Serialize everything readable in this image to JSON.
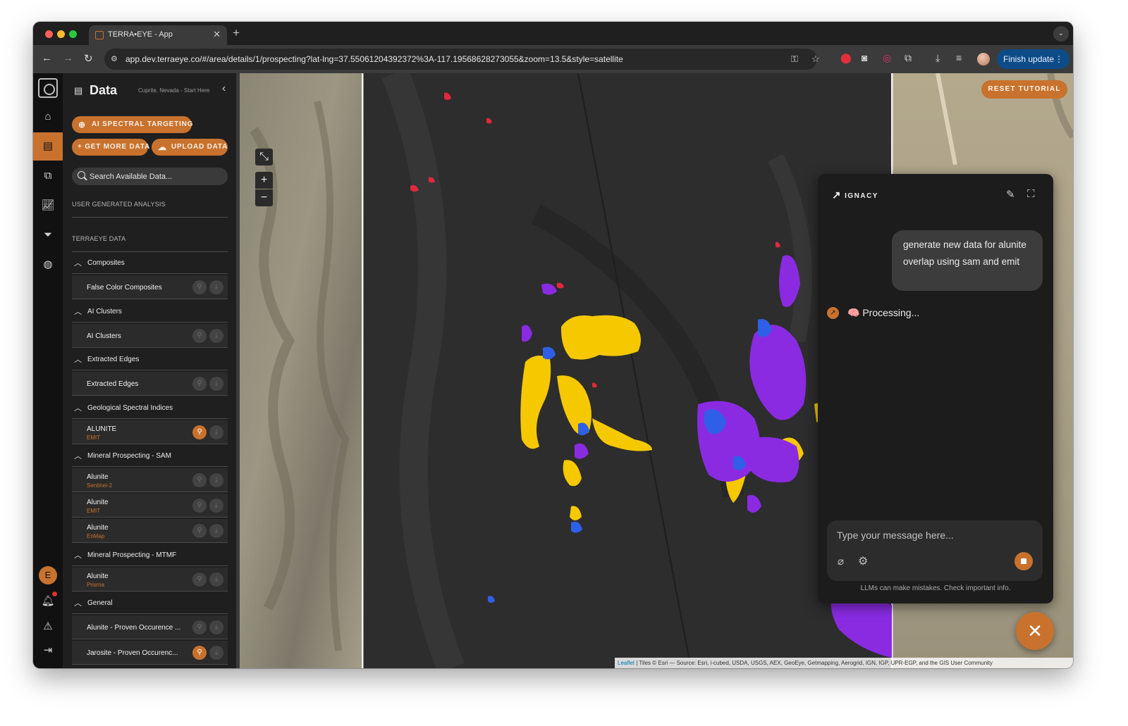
{
  "browser": {
    "tab_title": "TERRA•EYE - App",
    "url": "app.dev.terraeye.co/#/area/details/1/prospecting?lat-lng=37.55061204392372%3A-117.19568628273055&zoom=13.5&style=satellite",
    "finish_update_label": "Finish update"
  },
  "panel": {
    "title": "Data",
    "location": "Cuprite, Nevada - Start Here",
    "ai_targeting_label": "AI SPECTRAL TARGETING",
    "get_more_label": "+ GET MORE DATA",
    "upload_label": "UPLOAD DATA",
    "search_placeholder": "Search Available Data...",
    "user_section": "USER GENERATED ANALYSIS",
    "terraeye_section": "TERRAEYE DATA",
    "groups": [
      {
        "label": "Composites"
      },
      {
        "label": "AI Clusters"
      },
      {
        "label": "Extracted Edges"
      },
      {
        "label": "Geological Spectral Indices"
      },
      {
        "label": "Mineral Prospecting - SAM"
      },
      {
        "label": "Mineral Prospecting - MTMF"
      },
      {
        "label": "General"
      }
    ],
    "layers": [
      {
        "name": "False Color Composites",
        "sub": ""
      },
      {
        "name": "AI Clusters",
        "sub": ""
      },
      {
        "name": "Extracted Edges",
        "sub": ""
      },
      {
        "name": "ALUNITE",
        "sub": "EMIT",
        "active": true
      },
      {
        "name": "Alunite",
        "sub": "Sentinel-2"
      },
      {
        "name": "Alunite",
        "sub": "EMIT"
      },
      {
        "name": "Alunite",
        "sub": "EnMap"
      },
      {
        "name": "Alunite",
        "sub": "Prisma"
      },
      {
        "name": "Alunite - Proven Occurence ...",
        "sub": ""
      },
      {
        "name": "Jarosite - Proven Occurenc...",
        "sub": "",
        "active": true
      }
    ]
  },
  "rail": {
    "user_initial": "E"
  },
  "map": {
    "reset_label": "RESET TUTORIAL",
    "zoom_in": "+",
    "zoom_out": "−",
    "attribution_leaflet": "Leaflet",
    "attribution_text": "| Tiles © Esri — Source: Esri, i-cubed, USDA, USGS, AEX, GeoEye, Getmapping, Aerogrid, IGN, IGP, UPR-EGP, and the GIS User Community"
  },
  "chat": {
    "brand": "IGNACY",
    "user_message": "generate new data for alunite overlap using sam and emit",
    "bot_status": "🧠 Processing...",
    "input_placeholder": "Type your message here...",
    "disclaimer": "LLMs can make mistakes. Check important info."
  },
  "colors": {
    "accent": "#c8722e",
    "overlay_yellow": "#f5c800",
    "overlay_purple": "#8a2be2",
    "overlay_blue": "#2f5fe6",
    "overlay_red": "#e0283c"
  }
}
